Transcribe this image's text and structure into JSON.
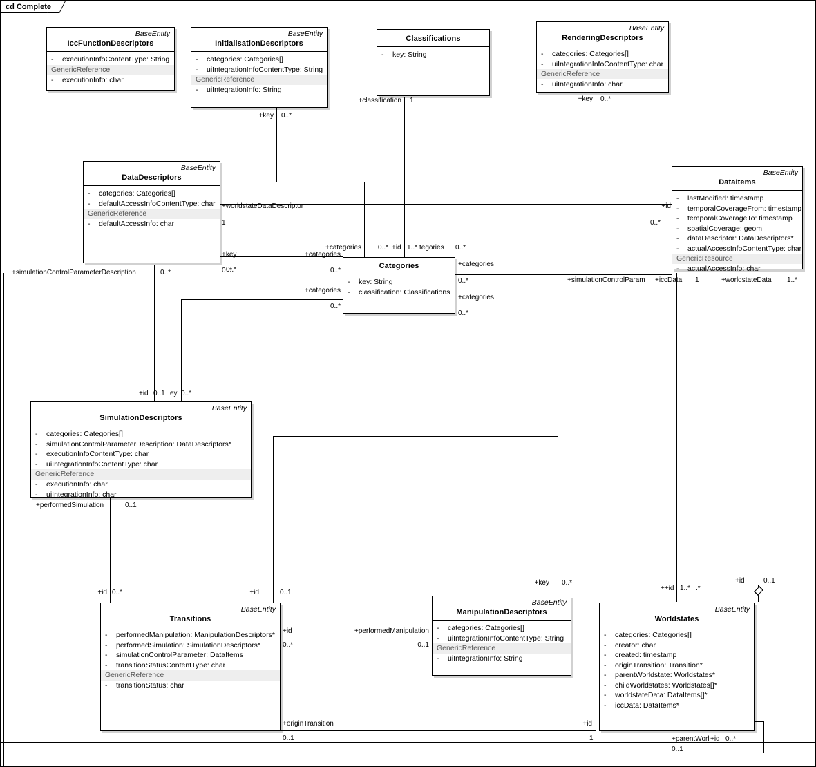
{
  "frame": {
    "label": "cd Complete"
  },
  "classes": [
    {
      "id": "iccFunctionDescriptors",
      "stereotype": "BaseEntity",
      "name": "IccFunctionDescriptors",
      "attrs": [
        {
          "vis": "-",
          "text": "executionInfoContentType:  String"
        }
      ],
      "group": "GenericReference",
      "group_attrs": [
        {
          "vis": "-",
          "text": "executionInfo:  char"
        }
      ]
    },
    {
      "id": "initialisationDescriptors",
      "stereotype": "BaseEntity",
      "name": "InitialisationDescriptors",
      "attrs": [
        {
          "vis": "-",
          "text": "categories:  Categories[]"
        },
        {
          "vis": "-",
          "text": "uiIntegrationInfoContentType:  String"
        }
      ],
      "group": "GenericReference",
      "group_attrs": [
        {
          "vis": "-",
          "text": "uiIntegrationInfo:  String"
        }
      ]
    },
    {
      "id": "classifications",
      "stereotype": "",
      "name": "Classifications",
      "attrs": [
        {
          "vis": "-",
          "text": "key:  String"
        }
      ],
      "group": "",
      "group_attrs": []
    },
    {
      "id": "renderingDescriptors",
      "stereotype": "BaseEntity",
      "name": "RenderingDescriptors",
      "attrs": [
        {
          "vis": "-",
          "text": "categories:  Categories[]"
        },
        {
          "vis": "-",
          "text": "uiIntegrationInfoContentType:  char"
        }
      ],
      "group": "GenericReference",
      "group_attrs": [
        {
          "vis": "-",
          "text": "uiIntegrationInfo:  char"
        }
      ]
    },
    {
      "id": "dataDescriptors",
      "stereotype": "BaseEntity",
      "name": "DataDescriptors",
      "attrs": [
        {
          "vis": "-",
          "text": "categories:  Categories[]"
        },
        {
          "vis": "-",
          "text": "defaultAccessInfoContentType:  char"
        }
      ],
      "group": "GenericReference",
      "group_attrs": [
        {
          "vis": "-",
          "text": "defaultAccessInfo:  char"
        }
      ]
    },
    {
      "id": "dataItems",
      "stereotype": "BaseEntity",
      "name": "DataItems",
      "attrs": [
        {
          "vis": "-",
          "text": "lastModified:  timestamp"
        },
        {
          "vis": "-",
          "text": "temporalCoverageFrom:  timestamp"
        },
        {
          "vis": "-",
          "text": "temporalCoverageTo:  timestamp"
        },
        {
          "vis": "-",
          "text": "spatialCoverage:  geom"
        },
        {
          "vis": "-",
          "text": "dataDescriptor:  DataDescriptors*"
        },
        {
          "vis": "-",
          "text": "actualAccessInfoContentType:  char"
        }
      ],
      "group": "GenericResource",
      "group_attrs": [
        {
          "vis": "-",
          "text": "actualAccessInfo:  char"
        }
      ]
    },
    {
      "id": "categories",
      "stereotype": "",
      "name": "Categories",
      "attrs": [
        {
          "vis": "-",
          "text": "key:  String"
        },
        {
          "vis": "-",
          "text": "classification:  Classifications"
        }
      ],
      "group": "",
      "group_attrs": []
    },
    {
      "id": "simulationDescriptors",
      "stereotype": "BaseEntity",
      "name": "SimulationDescriptors",
      "attrs": [
        {
          "vis": "-",
          "text": "categories:  Categories[]"
        },
        {
          "vis": "-",
          "text": "simulationControlParameterDescription:  DataDescriptors*"
        },
        {
          "vis": "-",
          "text": "executionInfoContentType:  char"
        },
        {
          "vis": "-",
          "text": "uiIntegrationInfoContentType:  char"
        }
      ],
      "group": "GenericReference",
      "group_attrs": [
        {
          "vis": "-",
          "text": "executionInfo:  char"
        },
        {
          "vis": "-",
          "text": "uiIntegrationInfo:  char"
        }
      ]
    },
    {
      "id": "transitions",
      "stereotype": "BaseEntity",
      "name": "Transitions",
      "attrs": [
        {
          "vis": "-",
          "text": "performedManipulation:  ManipulationDescriptors*"
        },
        {
          "vis": "-",
          "text": "performedSimulation:  SimulationDescriptors*"
        },
        {
          "vis": "-",
          "text": "simulationControlParameter:  DataItems"
        },
        {
          "vis": "-",
          "text": "transitionStatusContentType:  char"
        }
      ],
      "group": "GenericReference",
      "group_attrs": [
        {
          "vis": "-",
          "text": "transitionStatus:  char"
        }
      ]
    },
    {
      "id": "manipulationDescriptors",
      "stereotype": "BaseEntity",
      "name": "ManipulationDescriptors",
      "attrs": [
        {
          "vis": "-",
          "text": "categories:  Categories[]"
        },
        {
          "vis": "-",
          "text": "uiIntegrationInfoContentType:  String"
        }
      ],
      "group": "GenericReference",
      "group_attrs": [
        {
          "vis": "-",
          "text": "uiIntegrationInfo:  String"
        }
      ]
    },
    {
      "id": "worldstates",
      "stereotype": "BaseEntity",
      "name": "Worldstates",
      "attrs": [
        {
          "vis": "-",
          "text": "categories:  Categories[]"
        },
        {
          "vis": "-",
          "text": "creator:  char"
        },
        {
          "vis": "-",
          "text": "created:  timestamp"
        },
        {
          "vis": "-",
          "text": "originTransition:  Transition*"
        },
        {
          "vis": "-",
          "text": "parentWorldstate:  Worldstates*"
        },
        {
          "vis": "-",
          "text": "childWorldstates:  Worldstates[]*"
        },
        {
          "vis": "-",
          "text": "worldstateData:  DataItems[]*"
        },
        {
          "vis": "-",
          "text": "iccData:  DataItems*"
        }
      ],
      "group": "",
      "group_attrs": []
    }
  ],
  "labels": [
    {
      "id": "l01",
      "text": "+key"
    },
    {
      "id": "l02",
      "text": "0..*"
    },
    {
      "id": "l03",
      "text": "+classification"
    },
    {
      "id": "l04",
      "text": "1"
    },
    {
      "id": "l05",
      "text": "+key"
    },
    {
      "id": "l06",
      "text": "0..*"
    },
    {
      "id": "l07",
      "text": "+worldstateDataDescriptor"
    },
    {
      "id": "l08",
      "text": "1"
    },
    {
      "id": "l09",
      "text": "+id"
    },
    {
      "id": "l10",
      "text": "0..*"
    },
    {
      "id": "l11",
      "text": "+key"
    },
    {
      "id": "l12",
      "text": "0..*"
    },
    {
      "id": "l13",
      "text": "+categories"
    },
    {
      "id": "l14",
      "text": "0..*"
    },
    {
      "id": "l15",
      "text": "+categories"
    },
    {
      "id": "l16",
      "text": "0..*"
    },
    {
      "id": "l17",
      "text": "+id"
    },
    {
      "id": "l18",
      "text": "1..*"
    },
    {
      "id": "l19",
      "text": "tegories"
    },
    {
      "id": "l20",
      "text": "0..*"
    },
    {
      "id": "l21",
      "text": "+categories"
    },
    {
      "id": "l22",
      "text": "0..*"
    },
    {
      "id": "l23",
      "text": "+categories"
    },
    {
      "id": "l24",
      "text": "0..*"
    },
    {
      "id": "l25",
      "text": "+categories"
    },
    {
      "id": "l26",
      "text": "0..*"
    },
    {
      "id": "l27",
      "text": "+simulationControlParameterDescription"
    },
    {
      "id": "l28",
      "text": "0..*"
    },
    {
      "id": "l29",
      "text": "0..*"
    },
    {
      "id": "l30",
      "text": "+simulationControlParam"
    },
    {
      "id": "l31",
      "text": "+iccData"
    },
    {
      "id": "l32",
      "text": "1"
    },
    {
      "id": "l33",
      "text": "+worldstateData"
    },
    {
      "id": "l34",
      "text": "1..*"
    },
    {
      "id": "l35",
      "text": "+id"
    },
    {
      "id": "l36",
      "text": "0..1"
    },
    {
      "id": "l37",
      "text": "ey"
    },
    {
      "id": "l38",
      "text": "0..*"
    },
    {
      "id": "l39",
      "text": "+performedSimulation"
    },
    {
      "id": "l40",
      "text": "0..1"
    },
    {
      "id": "l41",
      "text": "+id"
    },
    {
      "id": "l42",
      "text": "0..*"
    },
    {
      "id": "l43",
      "text": "+id"
    },
    {
      "id": "l44",
      "text": "0..1"
    },
    {
      "id": "l45",
      "text": "+key"
    },
    {
      "id": "l46",
      "text": "0..*"
    },
    {
      "id": "l47",
      "text": "++id"
    },
    {
      "id": "l48",
      "text": "1..*"
    },
    {
      "id": "l49",
      "text": ".*"
    },
    {
      "id": "l50",
      "text": "+id"
    },
    {
      "id": "l51",
      "text": "0..1"
    },
    {
      "id": "l52",
      "text": "+id"
    },
    {
      "id": "l53",
      "text": "0..*"
    },
    {
      "id": "l54",
      "text": "+performedManipulation"
    },
    {
      "id": "l55",
      "text": "0..1"
    },
    {
      "id": "l56",
      "text": "+originTransition"
    },
    {
      "id": "l57",
      "text": "0..1"
    },
    {
      "id": "l58",
      "text": "+id"
    },
    {
      "id": "l59",
      "text": "1"
    },
    {
      "id": "l60",
      "text": "+parentWorl"
    },
    {
      "id": "l61",
      "text": "+id"
    },
    {
      "id": "l62",
      "text": "0..*"
    },
    {
      "id": "l63",
      "text": "0..1"
    }
  ]
}
